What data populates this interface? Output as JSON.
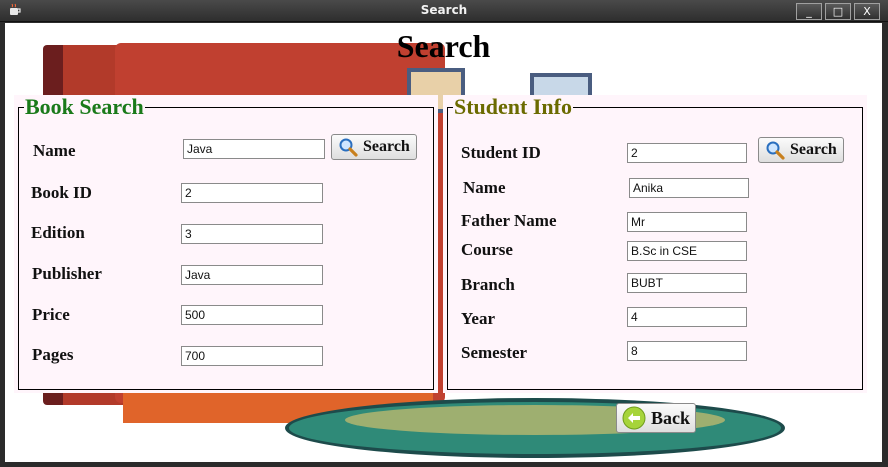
{
  "window": {
    "title": "Search",
    "minimize": "_",
    "maximize": "□",
    "close": "X"
  },
  "page": {
    "title": "Search"
  },
  "book_panel": {
    "legend": "Book Search",
    "legend_color": "#1a7a1a",
    "search_button": "Search",
    "fields": [
      {
        "label": "Name",
        "value": "Java"
      },
      {
        "label": "Book ID",
        "value": "2"
      },
      {
        "label": "Edition",
        "value": "3"
      },
      {
        "label": "Publisher",
        "value": "Java"
      },
      {
        "label": "Price",
        "value": "500"
      },
      {
        "label": "Pages",
        "value": "700"
      }
    ]
  },
  "student_panel": {
    "legend": "Student Info",
    "legend_color": "#6b6b00",
    "search_button": "Search",
    "fields": [
      {
        "label": "Student ID",
        "value": "2"
      },
      {
        "label": "Name",
        "value": "Anika"
      },
      {
        "label": "Father Name",
        "value": "Mr"
      },
      {
        "label": "Course",
        "value": "B.Sc in CSE"
      },
      {
        "label": "Branch",
        "value": "BUBT"
      },
      {
        "label": "Year",
        "value": "4"
      },
      {
        "label": "Semester",
        "value": "8"
      }
    ]
  },
  "back_button": "Back",
  "icons": {
    "search": "magnifier-icon",
    "back": "back-arrow-icon",
    "app": "coffee-cup-icon"
  }
}
